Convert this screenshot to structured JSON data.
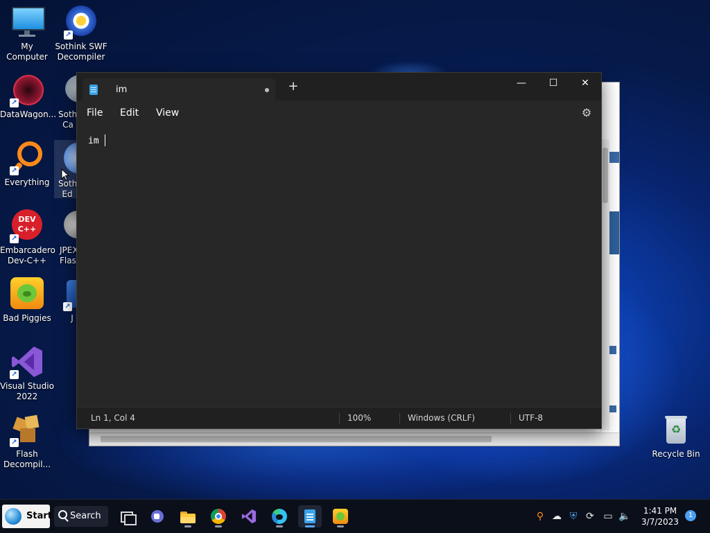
{
  "desktop": {
    "icons": [
      {
        "label": "My Computer"
      },
      {
        "label": "Sothink SWF Decompiler"
      },
      {
        "label": "DataWagon..."
      },
      {
        "label": "Sothi Ca"
      },
      {
        "label": "Everything"
      },
      {
        "label": "Sothi Ed"
      },
      {
        "label": "Embarcadero Dev-C++"
      },
      {
        "label": "JPEX Flash"
      },
      {
        "label": "Bad Piggies"
      },
      {
        "label": "J"
      },
      {
        "label": "Visual Studio 2022"
      },
      {
        "label": "Flash Decompil..."
      },
      {
        "label": "Recycle Bin"
      }
    ]
  },
  "notepad": {
    "tab_title": "im",
    "new_tab": "+",
    "window_controls": {
      "minimize": "—",
      "maximize": "☐",
      "close": "✕"
    },
    "menu": {
      "file": "File",
      "edit": "Edit",
      "view": "View"
    },
    "content": "im",
    "status": {
      "position": "Ln 1, Col 4",
      "zoom": "100%",
      "line_ending": "Windows (CRLF)",
      "encoding": "UTF-8"
    }
  },
  "taskbar": {
    "start_label": "Start",
    "search_label": "Search",
    "time": "1:41 PM",
    "date": "3/7/2023",
    "notification_count": "1"
  },
  "colors": {
    "notepad_bg": "#272727",
    "titlebar_bg": "#202020",
    "taskbar_bg": "#0b0f1a",
    "accent": "#4ba0f0"
  }
}
